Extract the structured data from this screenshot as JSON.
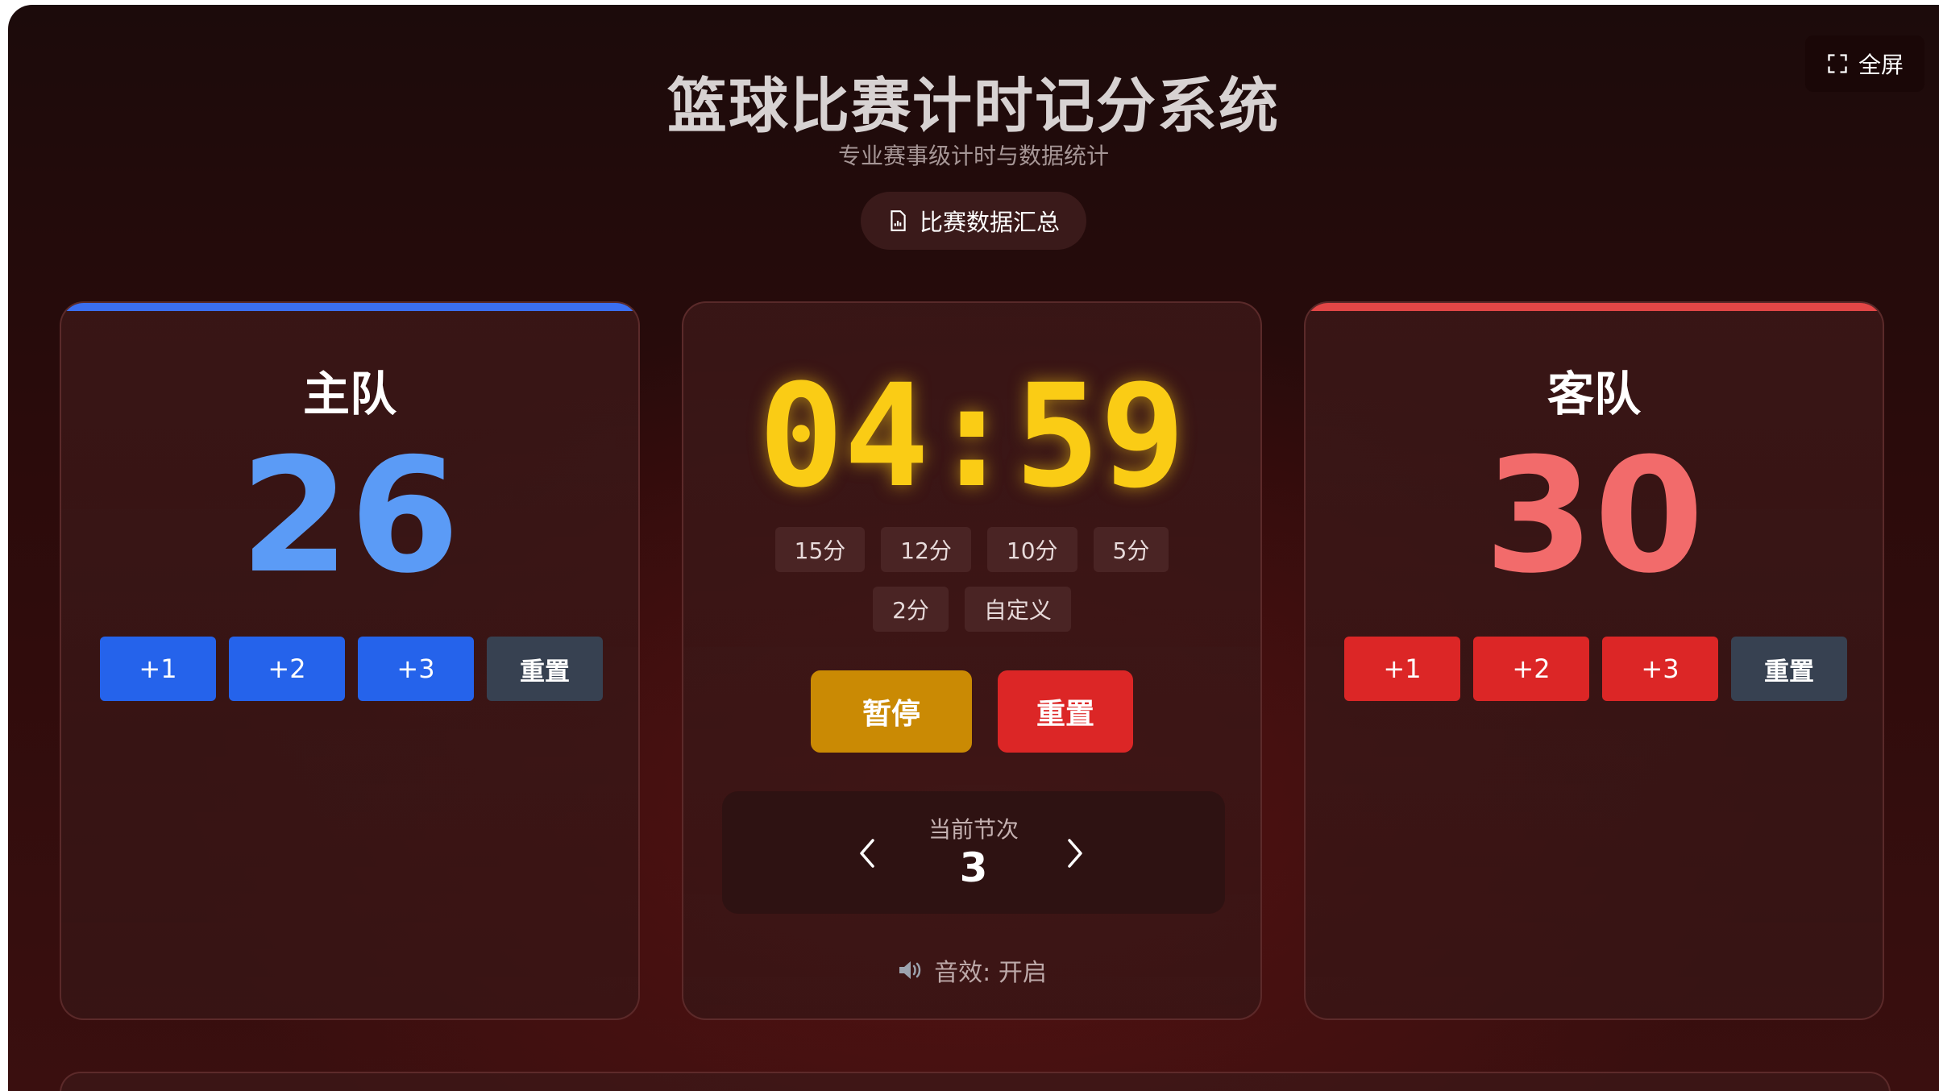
{
  "header": {
    "title": "篮球比赛计时记分系统",
    "subtitle": "专业赛事级计时与数据统计",
    "summary_label": "比赛数据汇总",
    "fullscreen_label": "全屏"
  },
  "home": {
    "name": "主队",
    "score": "26",
    "buttons": {
      "add1": "+1",
      "add2": "+2",
      "add3": "+3",
      "reset": "重置"
    },
    "accent": "#3b6ff0"
  },
  "away": {
    "name": "客队",
    "score": "30",
    "buttons": {
      "add1": "+1",
      "add2": "+2",
      "add3": "+3",
      "reset": "重置"
    },
    "accent": "#e24646"
  },
  "clock": {
    "time": "04:59",
    "presets": [
      "15分",
      "12分",
      "10分",
      "5分",
      "2分",
      "自定义"
    ],
    "pause_label": "暂停",
    "reset_label": "重置",
    "period_label": "当前节次",
    "period_value": "3",
    "sound_label": "音效: 开启",
    "timer_color": "#facc15"
  },
  "icons": {
    "fullscreen": "fullscreen-icon",
    "summary": "document-chart-icon",
    "prev": "chevron-left-icon",
    "next": "chevron-right-icon",
    "sound": "speaker-icon"
  }
}
